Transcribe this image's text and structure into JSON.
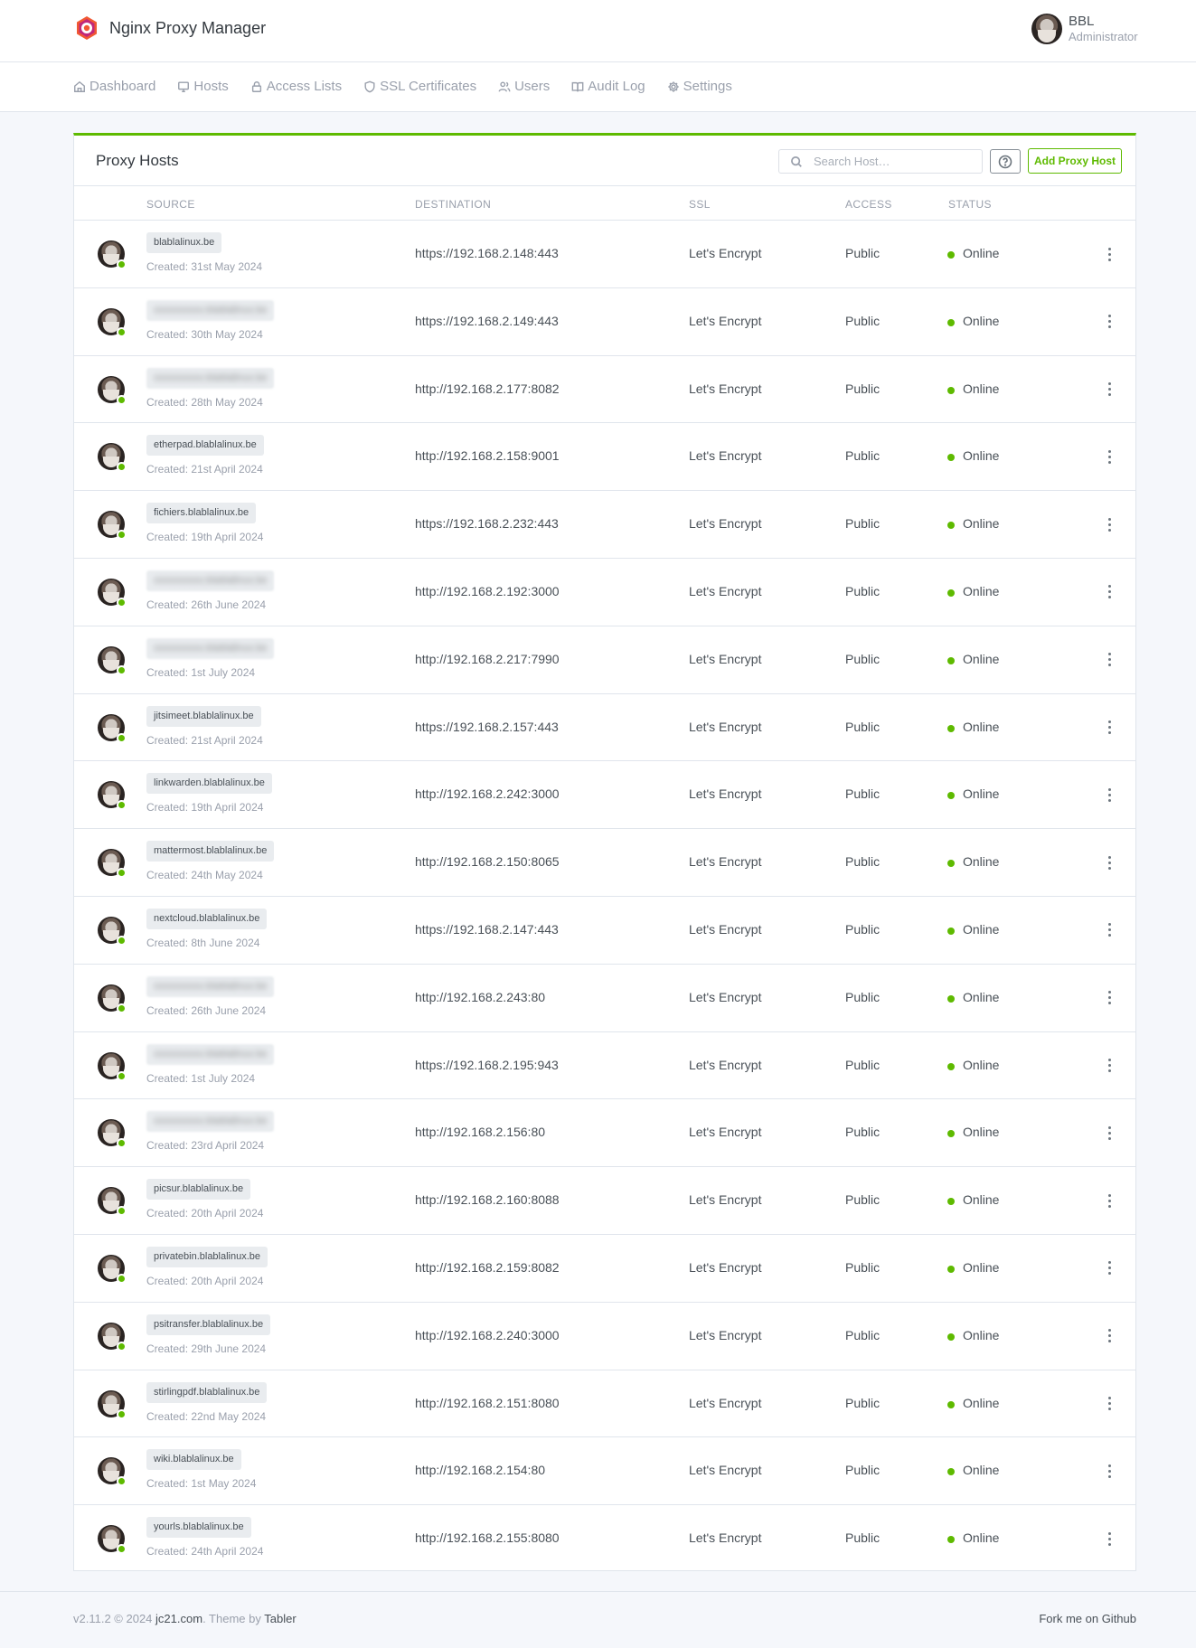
{
  "app": {
    "name": "Nginx Proxy Manager",
    "user_name": "BBL",
    "user_role": "Administrator"
  },
  "nav": [
    {
      "label": "Dashboard",
      "icon": "home-icon"
    },
    {
      "label": "Hosts",
      "icon": "monitor-icon"
    },
    {
      "label": "Access Lists",
      "icon": "lock-icon"
    },
    {
      "label": "SSL Certificates",
      "icon": "shield-icon"
    },
    {
      "label": "Users",
      "icon": "users-icon"
    },
    {
      "label": "Audit Log",
      "icon": "book-icon"
    },
    {
      "label": "Settings",
      "icon": "gear-icon"
    }
  ],
  "card": {
    "title": "Proxy Hosts",
    "search_placeholder": "Search Host…",
    "add_label": "Add Proxy Host"
  },
  "table": {
    "headers": {
      "source": "SOURCE",
      "destination": "DESTINATION",
      "ssl": "SSL",
      "access": "ACCESS",
      "status": "STATUS"
    },
    "rows": [
      {
        "source": "blablalinux.be",
        "blurred": false,
        "created": "Created: 31st May 2024",
        "destination": "https://192.168.2.148:443",
        "ssl": "Let's Encrypt",
        "access": "Public",
        "status": "Online"
      },
      {
        "source": "",
        "blurred": true,
        "created": "Created: 30th May 2024",
        "destination": "https://192.168.2.149:443",
        "ssl": "Let's Encrypt",
        "access": "Public",
        "status": "Online"
      },
      {
        "source": "",
        "blurred": true,
        "created": "Created: 28th May 2024",
        "destination": "http://192.168.2.177:8082",
        "ssl": "Let's Encrypt",
        "access": "Public",
        "status": "Online"
      },
      {
        "source": "etherpad.blablalinux.be",
        "blurred": false,
        "created": "Created: 21st April 2024",
        "destination": "http://192.168.2.158:9001",
        "ssl": "Let's Encrypt",
        "access": "Public",
        "status": "Online"
      },
      {
        "source": "fichiers.blablalinux.be",
        "blurred": false,
        "created": "Created: 19th April 2024",
        "destination": "https://192.168.2.232:443",
        "ssl": "Let's Encrypt",
        "access": "Public",
        "status": "Online"
      },
      {
        "source": "",
        "blurred": true,
        "created": "Created: 26th June 2024",
        "destination": "http://192.168.2.192:3000",
        "ssl": "Let's Encrypt",
        "access": "Public",
        "status": "Online"
      },
      {
        "source": "",
        "blurred": true,
        "created": "Created: 1st July 2024",
        "destination": "http://192.168.2.217:7990",
        "ssl": "Let's Encrypt",
        "access": "Public",
        "status": "Online"
      },
      {
        "source": "jitsimeet.blablalinux.be",
        "blurred": false,
        "created": "Created: 21st April 2024",
        "destination": "https://192.168.2.157:443",
        "ssl": "Let's Encrypt",
        "access": "Public",
        "status": "Online"
      },
      {
        "source": "linkwarden.blablalinux.be",
        "blurred": false,
        "created": "Created: 19th April 2024",
        "destination": "http://192.168.2.242:3000",
        "ssl": "Let's Encrypt",
        "access": "Public",
        "status": "Online"
      },
      {
        "source": "mattermost.blablalinux.be",
        "blurred": false,
        "created": "Created: 24th May 2024",
        "destination": "http://192.168.2.150:8065",
        "ssl": "Let's Encrypt",
        "access": "Public",
        "status": "Online"
      },
      {
        "source": "nextcloud.blablalinux.be",
        "blurred": false,
        "created": "Created: 8th June 2024",
        "destination": "https://192.168.2.147:443",
        "ssl": "Let's Encrypt",
        "access": "Public",
        "status": "Online"
      },
      {
        "source": "",
        "blurred": true,
        "created": "Created: 26th June 2024",
        "destination": "http://192.168.2.243:80",
        "ssl": "Let's Encrypt",
        "access": "Public",
        "status": "Online"
      },
      {
        "source": "",
        "blurred": true,
        "created": "Created: 1st July 2024",
        "destination": "https://192.168.2.195:943",
        "ssl": "Let's Encrypt",
        "access": "Public",
        "status": "Online"
      },
      {
        "source": "",
        "blurred": true,
        "created": "Created: 23rd April 2024",
        "destination": "http://192.168.2.156:80",
        "ssl": "Let's Encrypt",
        "access": "Public",
        "status": "Online"
      },
      {
        "source": "picsur.blablalinux.be",
        "blurred": false,
        "created": "Created: 20th April 2024",
        "destination": "http://192.168.2.160:8088",
        "ssl": "Let's Encrypt",
        "access": "Public",
        "status": "Online"
      },
      {
        "source": "privatebin.blablalinux.be",
        "blurred": false,
        "created": "Created: 20th April 2024",
        "destination": "http://192.168.2.159:8082",
        "ssl": "Let's Encrypt",
        "access": "Public",
        "status": "Online"
      },
      {
        "source": "psitransfer.blablalinux.be",
        "blurred": false,
        "created": "Created: 29th June 2024",
        "destination": "http://192.168.2.240:3000",
        "ssl": "Let's Encrypt",
        "access": "Public",
        "status": "Online"
      },
      {
        "source": "stirlingpdf.blablalinux.be",
        "blurred": false,
        "created": "Created: 22nd May 2024",
        "destination": "http://192.168.2.151:8080",
        "ssl": "Let's Encrypt",
        "access": "Public",
        "status": "Online"
      },
      {
        "source": "wiki.blablalinux.be",
        "blurred": false,
        "created": "Created: 1st May 2024",
        "destination": "http://192.168.2.154:80",
        "ssl": "Let's Encrypt",
        "access": "Public",
        "status": "Online"
      },
      {
        "source": "yourls.blablalinux.be",
        "blurred": false,
        "created": "Created: 24th April 2024",
        "destination": "http://192.168.2.155:8080",
        "ssl": "Let's Encrypt",
        "access": "Public",
        "status": "Online"
      }
    ]
  },
  "footer": {
    "version": "v2.11.2 © 2024",
    "author": "jc21.com",
    "theme_text": ". Theme by",
    "theme_name": "Tabler",
    "github": "Fork me on Github"
  },
  "colors": {
    "accent": "#5eba00",
    "status_online": "#5eba00"
  }
}
